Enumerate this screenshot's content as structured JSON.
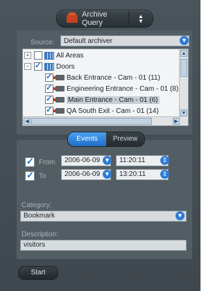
{
  "header": {
    "mode_label": "Archive Query",
    "mode_icon": "archive-icon"
  },
  "source": {
    "label": "Source:",
    "value": "Default archiver"
  },
  "tree": {
    "items": [
      {
        "label": "All Areas",
        "expander": "+",
        "checked": false
      },
      {
        "label": "Doors",
        "expander": "−",
        "checked": true
      },
      {
        "label": "Back Entrance - Cam - 01 (11)",
        "checked": true
      },
      {
        "label": "Engineering Entrance - Cam - 01 (8)",
        "checked": true
      },
      {
        "label": "Main Entrance - Cam - 01 (6)",
        "checked": true,
        "selected": true
      },
      {
        "label": "QA South Exit - Cam - 01 (14)",
        "checked": true
      }
    ]
  },
  "tabs": {
    "events": "Events",
    "preview": "Preview",
    "active": "Events"
  },
  "from": {
    "label": "From",
    "date": "2006-06-09",
    "time": "11:20:11",
    "checked": true
  },
  "to": {
    "label": "To",
    "date": "2006-06-09",
    "time": "13:20:11",
    "checked": true
  },
  "category": {
    "label": "Category:",
    "value": "Bookmark"
  },
  "description": {
    "label": "Description:",
    "value": "visitors"
  },
  "actions": {
    "start": "Start"
  },
  "colors": {
    "accent": "#2e7bd6",
    "panel": "#4a545b"
  }
}
